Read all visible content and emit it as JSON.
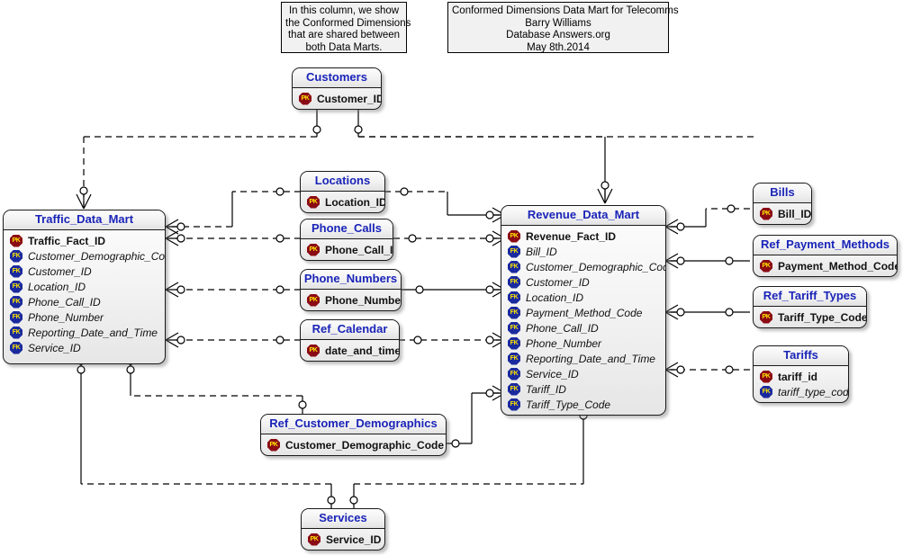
{
  "diagram": {
    "title": "Conformed Dimensions Data Mart for Telecomms",
    "colors": {
      "entity_title": "#1a24b8",
      "pk_badge": "#8b0b14",
      "fk_badge": "#1a2a9e",
      "badge_text": "#ffe400",
      "line": "#000000",
      "note_bg": "#f1f1f1"
    }
  },
  "notes": [
    {
      "id": "column-note",
      "lines": [
        "In this column, we show",
        "the Conformed Dimensions",
        "that are shared between",
        "both Data Marts."
      ]
    },
    {
      "id": "title-note",
      "lines": [
        "Conformed Dimensions Data Mart for Telecomms",
        "Barry Williams",
        "Database Answers.org",
        "May 8th.2014"
      ]
    }
  ],
  "entities": [
    {
      "id": "customers",
      "name": "Customers",
      "attributes": [
        {
          "key": "PK",
          "name": "Customer_ID"
        }
      ]
    },
    {
      "id": "locations",
      "name": "Locations",
      "attributes": [
        {
          "key": "PK",
          "name": "Location_ID"
        }
      ]
    },
    {
      "id": "phone_calls",
      "name": "Phone_Calls",
      "attributes": [
        {
          "key": "PK",
          "name": "Phone_Call_ID"
        }
      ]
    },
    {
      "id": "phone_numbers",
      "name": "Phone_Numbers",
      "attributes": [
        {
          "key": "PK",
          "name": "Phone_Number"
        }
      ]
    },
    {
      "id": "ref_calendar",
      "name": "Ref_Calendar",
      "attributes": [
        {
          "key": "PK",
          "name": "date_and_time"
        }
      ]
    },
    {
      "id": "traffic_data_mart",
      "name": "Traffic_Data_Mart",
      "attributes": [
        {
          "key": "PK",
          "name": "Traffic_Fact_ID"
        },
        {
          "key": "FK",
          "name": "Customer_Demographic_Code"
        },
        {
          "key": "FK",
          "name": "Customer_ID"
        },
        {
          "key": "FK",
          "name": "Location_ID"
        },
        {
          "key": "FK",
          "name": "Phone_Call_ID"
        },
        {
          "key": "FK",
          "name": "Phone_Number"
        },
        {
          "key": "FK",
          "name": "Reporting_Date_and_Time"
        },
        {
          "key": "FK",
          "name": "Service_ID"
        }
      ]
    },
    {
      "id": "revenue_data_mart",
      "name": "Revenue_Data_Mart",
      "attributes": [
        {
          "key": "PK",
          "name": "Revenue_Fact_ID"
        },
        {
          "key": "FK",
          "name": "Bill_ID"
        },
        {
          "key": "FK",
          "name": "Customer_Demographic_Code"
        },
        {
          "key": "FK",
          "name": "Customer_ID"
        },
        {
          "key": "FK",
          "name": "Location_ID"
        },
        {
          "key": "FK",
          "name": "Payment_Method_Code"
        },
        {
          "key": "FK",
          "name": "Phone_Call_ID"
        },
        {
          "key": "FK",
          "name": "Phone_Number"
        },
        {
          "key": "FK",
          "name": "Reporting_Date_and_Time"
        },
        {
          "key": "FK",
          "name": "Service_ID"
        },
        {
          "key": "FK",
          "name": "Tariff_ID"
        },
        {
          "key": "FK",
          "name": "Tariff_Type_Code"
        }
      ]
    },
    {
      "id": "bills",
      "name": "Bills",
      "attributes": [
        {
          "key": "PK",
          "name": "Bill_ID"
        }
      ]
    },
    {
      "id": "ref_payment_methods",
      "name": "Ref_Payment_Methods",
      "attributes": [
        {
          "key": "PK",
          "name": "Payment_Method_Code"
        }
      ]
    },
    {
      "id": "ref_tariff_types",
      "name": "Ref_Tariff_Types",
      "attributes": [
        {
          "key": "PK",
          "name": "Tariff_Type_Code"
        }
      ]
    },
    {
      "id": "tariffs",
      "name": "Tariffs",
      "attributes": [
        {
          "key": "PK",
          "name": "tariff_id"
        },
        {
          "key": "FK",
          "name": "tariff_type_code"
        }
      ]
    },
    {
      "id": "ref_customer_demographics",
      "name": "Ref_Customer_Demographics",
      "attributes": [
        {
          "key": "PK",
          "name": "Customer_Demographic_Code"
        }
      ]
    },
    {
      "id": "services",
      "name": "Services",
      "attributes": [
        {
          "key": "PK",
          "name": "Service_ID"
        }
      ]
    }
  ]
}
